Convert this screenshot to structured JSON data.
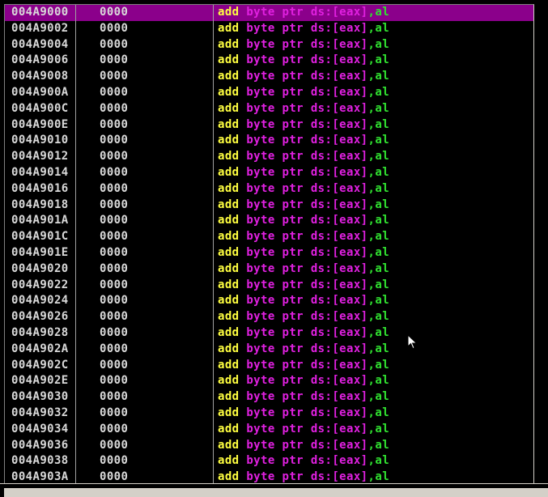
{
  "disassembly": {
    "rows": [
      {
        "address": "004A9000",
        "hex": "0000",
        "mnemonic": "add",
        "size": "byte ptr",
        "segment": "ds:",
        "open": "[",
        "reg1": "eax",
        "close": "]",
        "comma": ",",
        "reg2": "al"
      },
      {
        "address": "004A9002",
        "hex": "0000",
        "mnemonic": "add",
        "size": "byte ptr",
        "segment": "ds:",
        "open": "[",
        "reg1": "eax",
        "close": "]",
        "comma": ",",
        "reg2": "al"
      },
      {
        "address": "004A9004",
        "hex": "0000",
        "mnemonic": "add",
        "size": "byte ptr",
        "segment": "ds:",
        "open": "[",
        "reg1": "eax",
        "close": "]",
        "comma": ",",
        "reg2": "al"
      },
      {
        "address": "004A9006",
        "hex": "0000",
        "mnemonic": "add",
        "size": "byte ptr",
        "segment": "ds:",
        "open": "[",
        "reg1": "eax",
        "close": "]",
        "comma": ",",
        "reg2": "al"
      },
      {
        "address": "004A9008",
        "hex": "0000",
        "mnemonic": "add",
        "size": "byte ptr",
        "segment": "ds:",
        "open": "[",
        "reg1": "eax",
        "close": "]",
        "comma": ",",
        "reg2": "al"
      },
      {
        "address": "004A900A",
        "hex": "0000",
        "mnemonic": "add",
        "size": "byte ptr",
        "segment": "ds:",
        "open": "[",
        "reg1": "eax",
        "close": "]",
        "comma": ",",
        "reg2": "al"
      },
      {
        "address": "004A900C",
        "hex": "0000",
        "mnemonic": "add",
        "size": "byte ptr",
        "segment": "ds:",
        "open": "[",
        "reg1": "eax",
        "close": "]",
        "comma": ",",
        "reg2": "al"
      },
      {
        "address": "004A900E",
        "hex": "0000",
        "mnemonic": "add",
        "size": "byte ptr",
        "segment": "ds:",
        "open": "[",
        "reg1": "eax",
        "close": "]",
        "comma": ",",
        "reg2": "al"
      },
      {
        "address": "004A9010",
        "hex": "0000",
        "mnemonic": "add",
        "size": "byte ptr",
        "segment": "ds:",
        "open": "[",
        "reg1": "eax",
        "close": "]",
        "comma": ",",
        "reg2": "al"
      },
      {
        "address": "004A9012",
        "hex": "0000",
        "mnemonic": "add",
        "size": "byte ptr",
        "segment": "ds:",
        "open": "[",
        "reg1": "eax",
        "close": "]",
        "comma": ",",
        "reg2": "al"
      },
      {
        "address": "004A9014",
        "hex": "0000",
        "mnemonic": "add",
        "size": "byte ptr",
        "segment": "ds:",
        "open": "[",
        "reg1": "eax",
        "close": "]",
        "comma": ",",
        "reg2": "al"
      },
      {
        "address": "004A9016",
        "hex": "0000",
        "mnemonic": "add",
        "size": "byte ptr",
        "segment": "ds:",
        "open": "[",
        "reg1": "eax",
        "close": "]",
        "comma": ",",
        "reg2": "al"
      },
      {
        "address": "004A9018",
        "hex": "0000",
        "mnemonic": "add",
        "size": "byte ptr",
        "segment": "ds:",
        "open": "[",
        "reg1": "eax",
        "close": "]",
        "comma": ",",
        "reg2": "al"
      },
      {
        "address": "004A901A",
        "hex": "0000",
        "mnemonic": "add",
        "size": "byte ptr",
        "segment": "ds:",
        "open": "[",
        "reg1": "eax",
        "close": "]",
        "comma": ",",
        "reg2": "al"
      },
      {
        "address": "004A901C",
        "hex": "0000",
        "mnemonic": "add",
        "size": "byte ptr",
        "segment": "ds:",
        "open": "[",
        "reg1": "eax",
        "close": "]",
        "comma": ",",
        "reg2": "al"
      },
      {
        "address": "004A901E",
        "hex": "0000",
        "mnemonic": "add",
        "size": "byte ptr",
        "segment": "ds:",
        "open": "[",
        "reg1": "eax",
        "close": "]",
        "comma": ",",
        "reg2": "al"
      },
      {
        "address": "004A9020",
        "hex": "0000",
        "mnemonic": "add",
        "size": "byte ptr",
        "segment": "ds:",
        "open": "[",
        "reg1": "eax",
        "close": "]",
        "comma": ",",
        "reg2": "al"
      },
      {
        "address": "004A9022",
        "hex": "0000",
        "mnemonic": "add",
        "size": "byte ptr",
        "segment": "ds:",
        "open": "[",
        "reg1": "eax",
        "close": "]",
        "comma": ",",
        "reg2": "al"
      },
      {
        "address": "004A9024",
        "hex": "0000",
        "mnemonic": "add",
        "size": "byte ptr",
        "segment": "ds:",
        "open": "[",
        "reg1": "eax",
        "close": "]",
        "comma": ",",
        "reg2": "al"
      },
      {
        "address": "004A9026",
        "hex": "0000",
        "mnemonic": "add",
        "size": "byte ptr",
        "segment": "ds:",
        "open": "[",
        "reg1": "eax",
        "close": "]",
        "comma": ",",
        "reg2": "al"
      },
      {
        "address": "004A9028",
        "hex": "0000",
        "mnemonic": "add",
        "size": "byte ptr",
        "segment": "ds:",
        "open": "[",
        "reg1": "eax",
        "close": "]",
        "comma": ",",
        "reg2": "al"
      },
      {
        "address": "004A902A",
        "hex": "0000",
        "mnemonic": "add",
        "size": "byte ptr",
        "segment": "ds:",
        "open": "[",
        "reg1": "eax",
        "close": "]",
        "comma": ",",
        "reg2": "al"
      },
      {
        "address": "004A902C",
        "hex": "0000",
        "mnemonic": "add",
        "size": "byte ptr",
        "segment": "ds:",
        "open": "[",
        "reg1": "eax",
        "close": "]",
        "comma": ",",
        "reg2": "al"
      },
      {
        "address": "004A902E",
        "hex": "0000",
        "mnemonic": "add",
        "size": "byte ptr",
        "segment": "ds:",
        "open": "[",
        "reg1": "eax",
        "close": "]",
        "comma": ",",
        "reg2": "al"
      },
      {
        "address": "004A9030",
        "hex": "0000",
        "mnemonic": "add",
        "size": "byte ptr",
        "segment": "ds:",
        "open": "[",
        "reg1": "eax",
        "close": "]",
        "comma": ",",
        "reg2": "al"
      },
      {
        "address": "004A9032",
        "hex": "0000",
        "mnemonic": "add",
        "size": "byte ptr",
        "segment": "ds:",
        "open": "[",
        "reg1": "eax",
        "close": "]",
        "comma": ",",
        "reg2": "al"
      },
      {
        "address": "004A9034",
        "hex": "0000",
        "mnemonic": "add",
        "size": "byte ptr",
        "segment": "ds:",
        "open": "[",
        "reg1": "eax",
        "close": "]",
        "comma": ",",
        "reg2": "al"
      },
      {
        "address": "004A9036",
        "hex": "0000",
        "mnemonic": "add",
        "size": "byte ptr",
        "segment": "ds:",
        "open": "[",
        "reg1": "eax",
        "close": "]",
        "comma": ",",
        "reg2": "al"
      },
      {
        "address": "004A9038",
        "hex": "0000",
        "mnemonic": "add",
        "size": "byte ptr",
        "segment": "ds:",
        "open": "[",
        "reg1": "eax",
        "close": "]",
        "comma": ",",
        "reg2": "al"
      },
      {
        "address": "004A903A",
        "hex": "0000",
        "mnemonic": "add",
        "size": "byte ptr",
        "segment": "ds:",
        "open": "[",
        "reg1": "eax",
        "close": "]",
        "comma": ",",
        "reg2": "al"
      }
    ],
    "selected_row": 0
  },
  "colors": {
    "background": "#000000",
    "selection": "#8b008b",
    "address_text": "#d9d9d9",
    "mnemonic": "#ffff40",
    "operand": "#e020e0",
    "register": "#30e030"
  },
  "cursor": {
    "icon": "mouse-pointer-icon"
  }
}
